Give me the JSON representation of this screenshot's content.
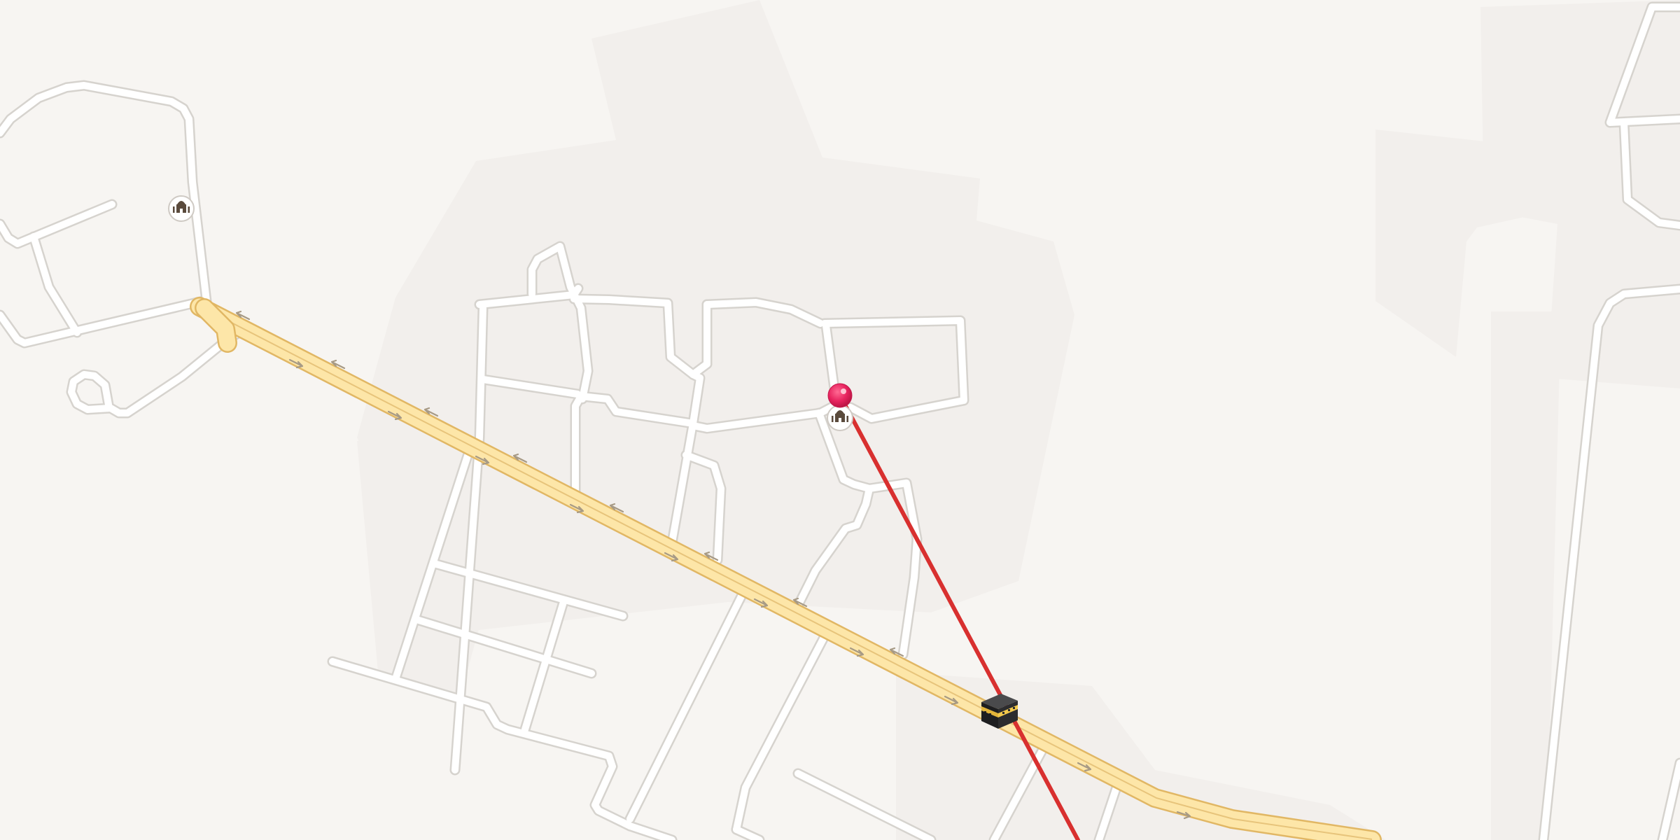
{
  "map": {
    "background_color": "#f7f5f2",
    "area_color": "#f2efec",
    "road_color": "#ffffff",
    "road_casing_color": "#d6d3ce",
    "highway_color": "#fde6a8",
    "highway_casing_color": "#e1b764",
    "highway_arrow_color": "#a79a85"
  },
  "qibla": {
    "line_color": "#d8302f",
    "destination_icon": "kaaba-icon"
  },
  "user_location": {
    "pin_color": "#e8245f",
    "icon": "location-pin-icon"
  },
  "points_of_interest": [
    {
      "icon": "mosque-icon"
    },
    {
      "icon": "mosque-icon"
    }
  ]
}
